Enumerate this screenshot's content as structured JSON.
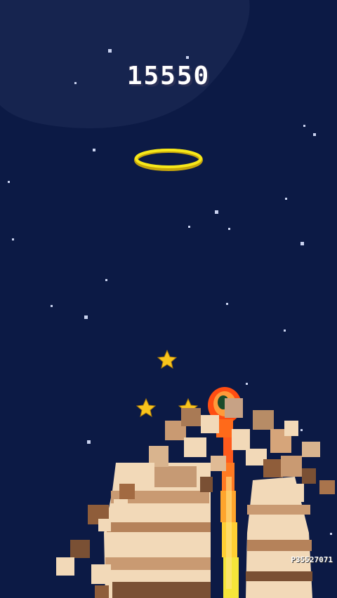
{
  "hud": {
    "score": "15550",
    "player_id": "P35527071"
  },
  "colors": {
    "background": "#0c1a45",
    "moon_shadow": "#16244f",
    "ring": "#f7e81a",
    "star_pickup": "#f8c41c",
    "rocket_flame": "#ff4d12",
    "trail": "#ffd23a",
    "planet_light": "#f2d9b8",
    "planet_mid": "#c99a72",
    "planet_dark": "#7a5034"
  },
  "icons": {
    "ring": "gold-ring-icon",
    "star": "star-pickup-icon",
    "rocket": "rocket-icon",
    "planet": "pixel-planet-icon"
  }
}
